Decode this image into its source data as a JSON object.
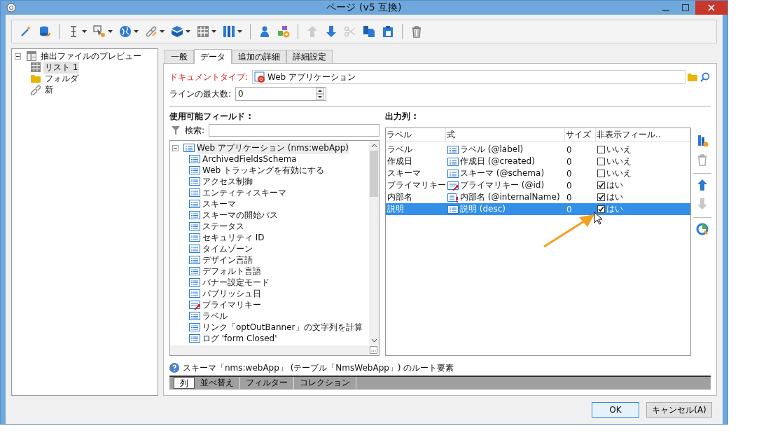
{
  "window": {
    "title": "ページ (v5 互換)"
  },
  "toolbar": [
    {
      "dropdown": false,
      "disabled": false
    },
    {
      "dropdown": false,
      "disabled": false
    },
    {
      "dropdown": true,
      "disabled": false
    },
    {
      "dropdown": true,
      "disabled": false
    },
    {
      "dropdown": true,
      "disabled": false
    },
    {
      "dropdown": true,
      "disabled": false
    },
    {
      "dropdown": true,
      "disabled": false
    },
    {
      "dropdown": true,
      "disabled": false
    },
    {
      "dropdown": true,
      "disabled": false
    },
    {
      "dropdown": false,
      "disabled": false
    },
    {
      "dropdown": false,
      "disabled": false
    },
    {
      "dropdown": false,
      "disabled": true
    },
    {
      "dropdown": false,
      "disabled": false
    },
    {
      "dropdown": false,
      "disabled": true
    },
    {
      "dropdown": false,
      "disabled": false
    },
    {
      "dropdown": false,
      "disabled": false
    },
    {
      "dropdown": false,
      "disabled": false
    }
  ],
  "sidebar": {
    "items": [
      {
        "label": "抽出ファイルのプレビュー",
        "kind": "page",
        "expanded": true,
        "selected": false,
        "children": [
          {
            "label": "リスト 1",
            "kind": "table",
            "selected": true
          },
          {
            "label": "フォルダ",
            "kind": "folder",
            "selected": false
          },
          {
            "label": "新",
            "kind": "link",
            "selected": false
          }
        ]
      }
    ]
  },
  "tabs": [
    {
      "label": "一般",
      "selected": false
    },
    {
      "label": "データ",
      "selected": true
    },
    {
      "label": "追加の詳細",
      "selected": false
    },
    {
      "label": "詳細設定",
      "selected": false
    }
  ],
  "document_type": {
    "label": "ドキュメントタイプ:",
    "value": "Web アプリケーション"
  },
  "max_lines": {
    "label": "ラインの最大数:",
    "value": "0"
  },
  "available_fields": {
    "title": "使用可能フィールド :",
    "search_label": "検索:",
    "tree": {
      "label": "Web アプリケーション (nms:webApp)",
      "expanded": true,
      "selected": true,
      "children": [
        {
          "label": "ArchivedFieldsSchema",
          "kind": "field",
          "selected": false
        },
        {
          "label": "Web トラッキングを有効にする",
          "kind": "field",
          "selected": false
        },
        {
          "label": "アクセス制御",
          "kind": "field",
          "selected": false
        },
        {
          "label": "エンティティスキーマ",
          "kind": "field",
          "selected": false
        },
        {
          "label": "スキーマ",
          "kind": "field",
          "selected": false
        },
        {
          "label": "スキーマの開始パス",
          "kind": "field",
          "selected": false
        },
        {
          "label": "ステータス",
          "kind": "field",
          "selected": false
        },
        {
          "label": "セキュリティ ID",
          "kind": "field",
          "selected": false
        },
        {
          "label": "タイムゾーン",
          "kind": "field",
          "selected": false
        },
        {
          "label": "デザイン言語",
          "kind": "field",
          "selected": false
        },
        {
          "label": "デフォルト言語",
          "kind": "field",
          "selected": false
        },
        {
          "label": "バナー設定モード",
          "kind": "field",
          "selected": false
        },
        {
          "label": "パブリッシュ日",
          "kind": "field",
          "selected": false
        },
        {
          "label": "プライマリキー",
          "kind": "key",
          "selected": false
        },
        {
          "label": "ラベル",
          "kind": "field",
          "selected": false
        },
        {
          "label": "リンク「optOutBanner」の文字列を計算",
          "kind": "field",
          "selected": false
        },
        {
          "label": "ログ 'form Closed'",
          "kind": "field",
          "selected": false
        }
      ]
    }
  },
  "output_columns": {
    "title": "出力列 :",
    "columns": [
      "ラベル",
      "式",
      "サイズ",
      "非表示フィール.."
    ],
    "rows": [
      {
        "label": "ラベル",
        "expression": "ラベル (@label)",
        "kind": "field",
        "size": "0",
        "hidden": false,
        "hidden_text": "いいえ",
        "selected": false
      },
      {
        "label": "作成日",
        "expression": "作成日 (@created)",
        "kind": "field",
        "size": "0",
        "hidden": false,
        "hidden_text": "いいえ",
        "selected": false
      },
      {
        "label": "スキーマ",
        "expression": "スキーマ (@schema)",
        "kind": "field",
        "size": "0",
        "hidden": false,
        "hidden_text": "いいえ",
        "selected": false
      },
      {
        "label": "プライマリキー",
        "expression": "プライマリキー (@id)",
        "kind": "key",
        "size": "0",
        "hidden": true,
        "hidden_text": "はい",
        "selected": false
      },
      {
        "label": "内部名",
        "expression": "内部名 (@internalName)",
        "kind": "required",
        "size": "0",
        "hidden": true,
        "hidden_text": "はい",
        "selected": false
      },
      {
        "label": "説明",
        "expression": "説明 (desc)",
        "kind": "field",
        "size": "0",
        "hidden": true,
        "hidden_text": "はい",
        "selected": true
      }
    ]
  },
  "side_buttons": [
    {
      "disabled": false
    },
    {
      "disabled": true
    },
    {
      "disabled": false
    },
    {
      "disabled": true
    },
    {
      "disabled": false
    }
  ],
  "status_text": "スキーマ「nms:webApp」 (テーブル「NmsWebApp」) のルート要素",
  "bottom_tabs": [
    {
      "label": "列",
      "selected": true
    },
    {
      "label": "並べ替え",
      "selected": false
    },
    {
      "label": "フィルター",
      "selected": false
    },
    {
      "label": "コレクション",
      "selected": false
    }
  ],
  "buttons": [
    {
      "label": "OK",
      "default": true
    },
    {
      "label": "キャンセル(A)",
      "default": false
    }
  ]
}
